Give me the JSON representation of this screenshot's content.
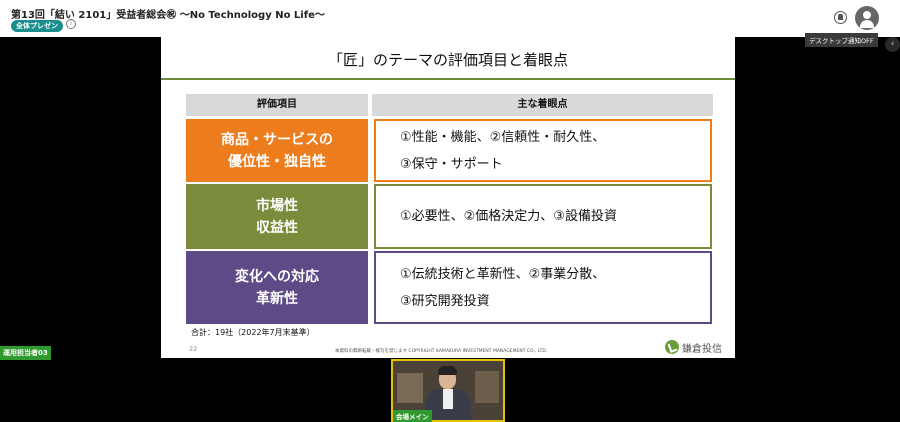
{
  "window": {
    "title": "第13回「結い 2101」受益者総会㊗ 〜No Technology No Life〜",
    "badge": "全体プレゼン",
    "info_icon": "info-icon",
    "mute_icon": "mic-mute-icon",
    "avatar_icon": "user-avatar-icon",
    "tooltip": "デスクトップ通知OFF",
    "collapse_icon": "chevron-left-icon"
  },
  "slide": {
    "title": "「匠」のテーマの評価項目と着眼点",
    "header_left": "評価項目",
    "header_right": "主な着眼点",
    "rows": [
      {
        "category": [
          "商品・サービスの",
          "優位性・独自性"
        ],
        "points": [
          "①性能・機能、②信頼性・耐久性、",
          "③保守・サポート"
        ],
        "color": "#ec7c1c",
        "border": "#ec7c1c"
      },
      {
        "category": [
          "市場性",
          "収益性"
        ],
        "points": [
          "①必要性、②価格決定力、③設備投資"
        ],
        "color": "#7a8c3c",
        "border": "#7a8c3c"
      },
      {
        "category": [
          "変化への対応",
          "革新性"
        ],
        "points": [
          "①伝統技術と革新性、②事業分散、",
          "③研究開発投資"
        ],
        "color": "#5e4a86",
        "border": "#5e4a86"
      }
    ],
    "total": "合計：19社（2022年7月末基準）",
    "page_number": "22",
    "copyright": "本資料の無断転載・複写を禁じます COPYRIGHT KAMAKURA INVESTMENT MANAGEMENT CO., LTD.",
    "logo_text": "鎌倉投信"
  },
  "participants": {
    "left_label": "運用担当者03",
    "video_label": "会場メイン"
  }
}
